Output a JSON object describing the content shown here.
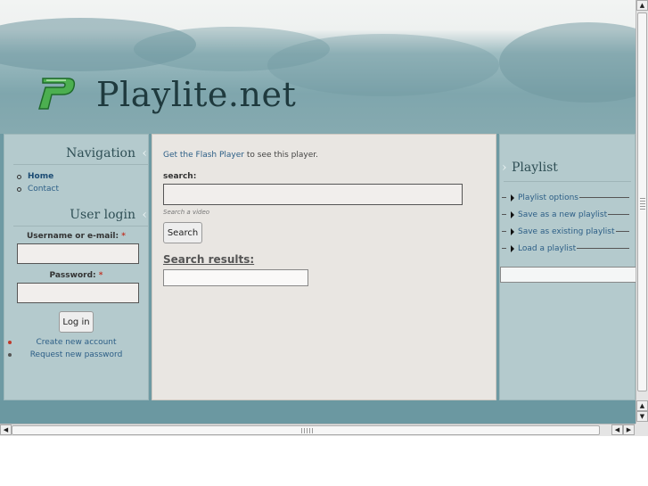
{
  "site": {
    "name": "Playlite.net",
    "logo_letter": "P"
  },
  "colors": {
    "header_bg": "#7fa6ad",
    "sidebar_bg": "#b4cacd",
    "main_bg": "#e9e6e2",
    "link": "#2c5e86",
    "logo_green": "#4caf50"
  },
  "navigation": {
    "title": "Navigation",
    "items": [
      {
        "label": "Home",
        "active": true
      },
      {
        "label": "Contact",
        "active": false
      }
    ]
  },
  "login": {
    "title": "User login",
    "username_label": "Username or e-mail:",
    "password_label": "Password:",
    "required_marker": "*",
    "submit_label": "Log in",
    "links": [
      "Create new account",
      "Request new password"
    ]
  },
  "main": {
    "flash_link": "Get the Flash Player",
    "flash_rest": "to see this player.",
    "search_label": "search:",
    "search_hint": "Search a video",
    "search_button": "Search",
    "results_title": "Search results:"
  },
  "playlist": {
    "title": "Playlist",
    "items": [
      "Playlist options",
      "Save as a new playlist",
      "Save as existing playlist",
      "Load a playlist"
    ]
  }
}
